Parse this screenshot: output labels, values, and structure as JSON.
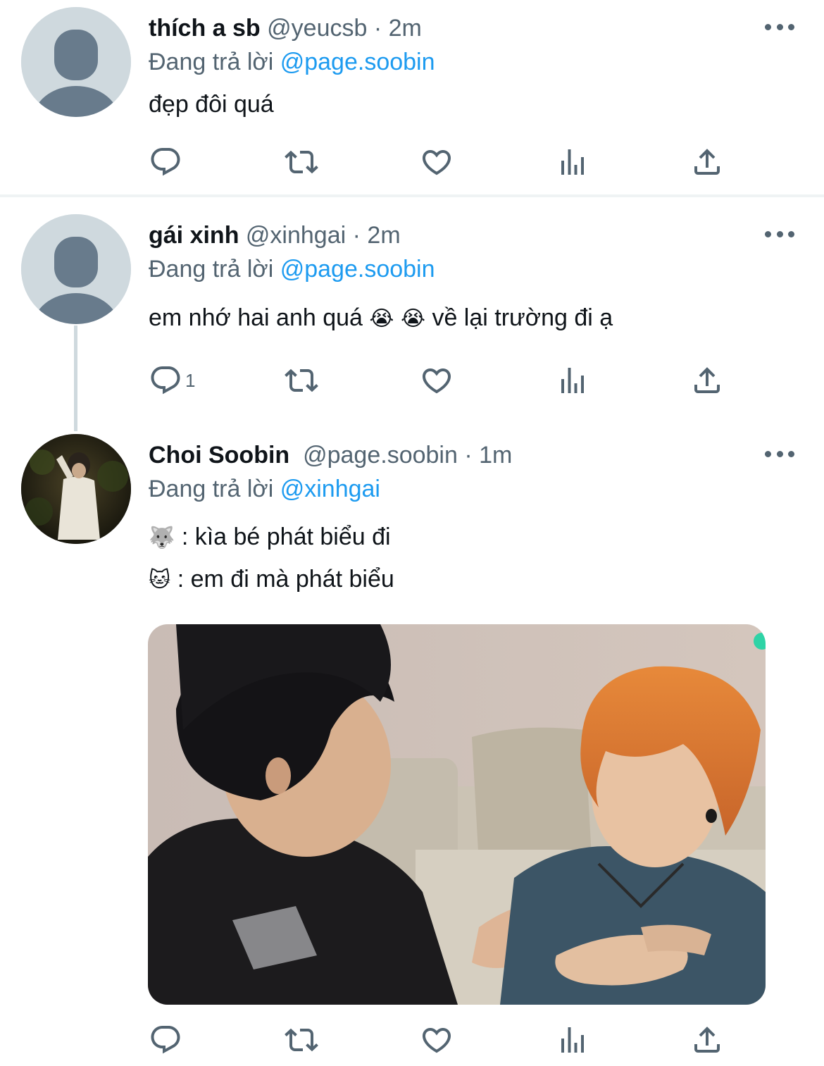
{
  "tweets": [
    {
      "name": "thích a sb",
      "handle": "@yeucsb",
      "time": "2m",
      "reply_prefix": "Đang trả lời",
      "reply_to": "@page.soobin",
      "text": "đẹp đôi quá",
      "reply_count": ""
    },
    {
      "name": "gái xinh",
      "handle": "@xinhgai",
      "time": "2m",
      "reply_prefix": "Đang trả lời",
      "reply_to": "@page.soobin",
      "text_before": "em nhớ hai anh quá",
      "emoji1": "😭",
      "emoji2": "😭",
      "text_after": "về lại trường đi ạ",
      "reply_count": "1"
    },
    {
      "name": "Choi Soobin",
      "handle": "@page.soobin",
      "time": "1m",
      "reply_prefix": "Đang trả lời",
      "reply_to": "@xinhgai",
      "line1_emoji": "🐺",
      "line1_text": ": kìa bé phát biểu đi",
      "line2_emoji": "🐱",
      "line2_text": ": em đi mà phát biểu",
      "reply_count": ""
    }
  ],
  "separator": "·",
  "icons": [
    "reply-icon",
    "retweet-icon",
    "like-icon",
    "views-icon",
    "share-icon",
    "more-icon"
  ],
  "colors": {
    "link": "#1d9bf0",
    "muted": "#536471",
    "text": "#0f1419",
    "avatar_bg": "#cfd9de",
    "avatar_fg": "#687b8c"
  }
}
